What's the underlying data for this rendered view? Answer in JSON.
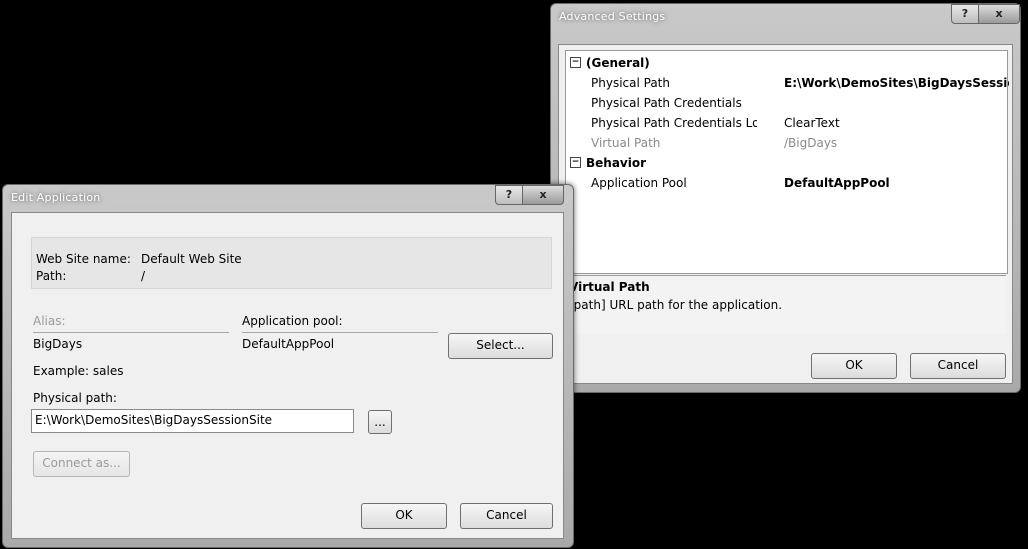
{
  "advanced_settings": {
    "title": "Advanced Settings",
    "help_button": "?",
    "close_button": "x",
    "categories": [
      {
        "toggle": "⊟",
        "name": "(General)",
        "properties": [
          {
            "name": "Physical Path",
            "value": "E:\\Work\\DemoSites\\BigDaysSessionS",
            "bold": true
          },
          {
            "name": "Physical Path Credentials",
            "value": ""
          },
          {
            "name": "Physical Path Credentials Logon T",
            "value": "ClearText"
          },
          {
            "name": "Virtual Path",
            "value": "/BigDays",
            "dim": true
          }
        ]
      },
      {
        "toggle": "⊟",
        "name": "Behavior",
        "properties": [
          {
            "name": "Application Pool",
            "value": "DefaultAppPool",
            "bold": true
          }
        ]
      }
    ],
    "description": {
      "title": "Virtual Path",
      "text": "[path] URL path for the application."
    },
    "ok_label": "OK",
    "cancel_label": "Cancel"
  },
  "edit_application": {
    "title": "Edit Application",
    "help_button": "?",
    "close_button": "x",
    "site_name_label": "Web Site name:",
    "site_name_value": "Default Web Site",
    "path_label": "Path:",
    "path_value": "/",
    "alias_label": "Alias:",
    "alias_value": "BigDays",
    "app_pool_label": "Application pool:",
    "app_pool_value": "DefaultAppPool",
    "select_label": "Select...",
    "example_text": "Example: sales",
    "physical_path_label": "Physical path:",
    "physical_path_value": "E:\\Work\\DemoSites\\BigDaysSessionSite",
    "browse_label": "...",
    "connect_as_label": "Connect as...",
    "ok_label": "OK",
    "cancel_label": "Cancel"
  }
}
